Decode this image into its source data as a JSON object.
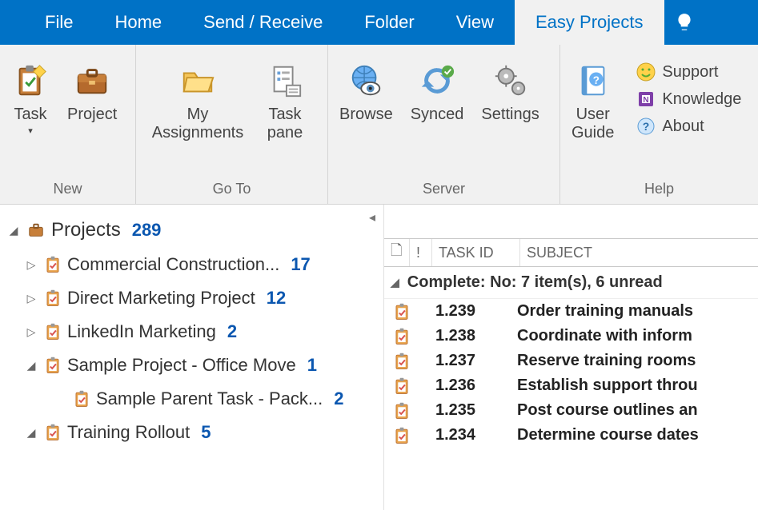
{
  "menubar": {
    "tabs": [
      "File",
      "Home",
      "Send / Receive",
      "Folder",
      "View",
      "Easy Projects"
    ],
    "activeIndex": 5
  },
  "ribbon": {
    "groups": [
      {
        "label": "New",
        "items": [
          {
            "name": "task-button",
            "caption": "Task",
            "hasDropdown": true,
            "icon": "clipboard-task"
          },
          {
            "name": "project-button",
            "caption": "Project",
            "icon": "briefcase"
          }
        ]
      },
      {
        "label": "Go To",
        "items": [
          {
            "name": "my-assignments-button",
            "caption": "My\nAssignments",
            "icon": "folder-open"
          },
          {
            "name": "task-pane-button",
            "caption": "Task\npane",
            "icon": "task-pane"
          }
        ]
      },
      {
        "label": "Server",
        "items": [
          {
            "name": "browse-button",
            "caption": "Browse",
            "icon": "globe-eye"
          },
          {
            "name": "synced-button",
            "caption": "Synced",
            "icon": "sync-check"
          },
          {
            "name": "settings-button",
            "caption": "Settings",
            "icon": "gears"
          }
        ]
      },
      {
        "label": "Help",
        "items": [
          {
            "name": "user-guide-button",
            "caption": "User\nGuide",
            "icon": "guide"
          }
        ],
        "sideItems": [
          {
            "name": "support-link",
            "label": "Support",
            "icon": "smiley"
          },
          {
            "name": "knowledge-link",
            "label": "Knowledge",
            "icon": "book"
          },
          {
            "name": "about-link",
            "label": "About",
            "icon": "question"
          }
        ]
      }
    ]
  },
  "tree": {
    "root": {
      "label": "Projects",
      "count": "289"
    },
    "items": [
      {
        "expander": "▷",
        "label": "Commercial Construction...",
        "count": "17"
      },
      {
        "expander": "▷",
        "label": "Direct Marketing Project",
        "count": "12"
      },
      {
        "expander": "▷",
        "label": "LinkedIn Marketing",
        "count": "2"
      },
      {
        "expander": "◢",
        "label": "Sample Project - Office Move",
        "count": "1",
        "children": [
          {
            "label": "Sample Parent Task - Pack...",
            "count": "2"
          }
        ]
      },
      {
        "expander": "◢",
        "label": "Training Rollout",
        "count": "5"
      }
    ]
  },
  "tasklist": {
    "columns": {
      "icon": "🗋",
      "flag": "!",
      "taskid": "TASK ID",
      "subject": "SUBJECT"
    },
    "group": "Complete: No: 7 item(s), 6 unread",
    "rows": [
      {
        "id": "1.239",
        "subject": "Order training manuals"
      },
      {
        "id": "1.238",
        "subject": "Coordinate with inform"
      },
      {
        "id": "1.237",
        "subject": "Reserve training rooms"
      },
      {
        "id": "1.236",
        "subject": "Establish support throu"
      },
      {
        "id": "1.235",
        "subject": "Post course outlines an"
      },
      {
        "id": "1.234",
        "subject": "Determine course dates"
      }
    ]
  }
}
